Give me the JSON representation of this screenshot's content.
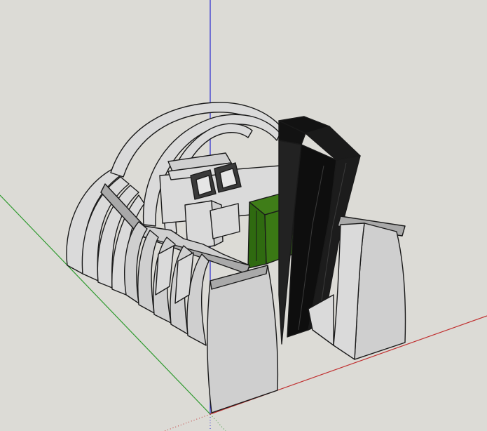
{
  "viewport": {
    "background_color": "#dcdbd6",
    "axis_colors": {
      "x": "#c03030",
      "y": "#2f9a2f",
      "z": "#2a2ad0"
    }
  },
  "model": {
    "panel_color": "#cfcfcf",
    "edge_color": "#1a1a1a",
    "seat_color": "#121212",
    "box_color": "#2f6a10"
  }
}
